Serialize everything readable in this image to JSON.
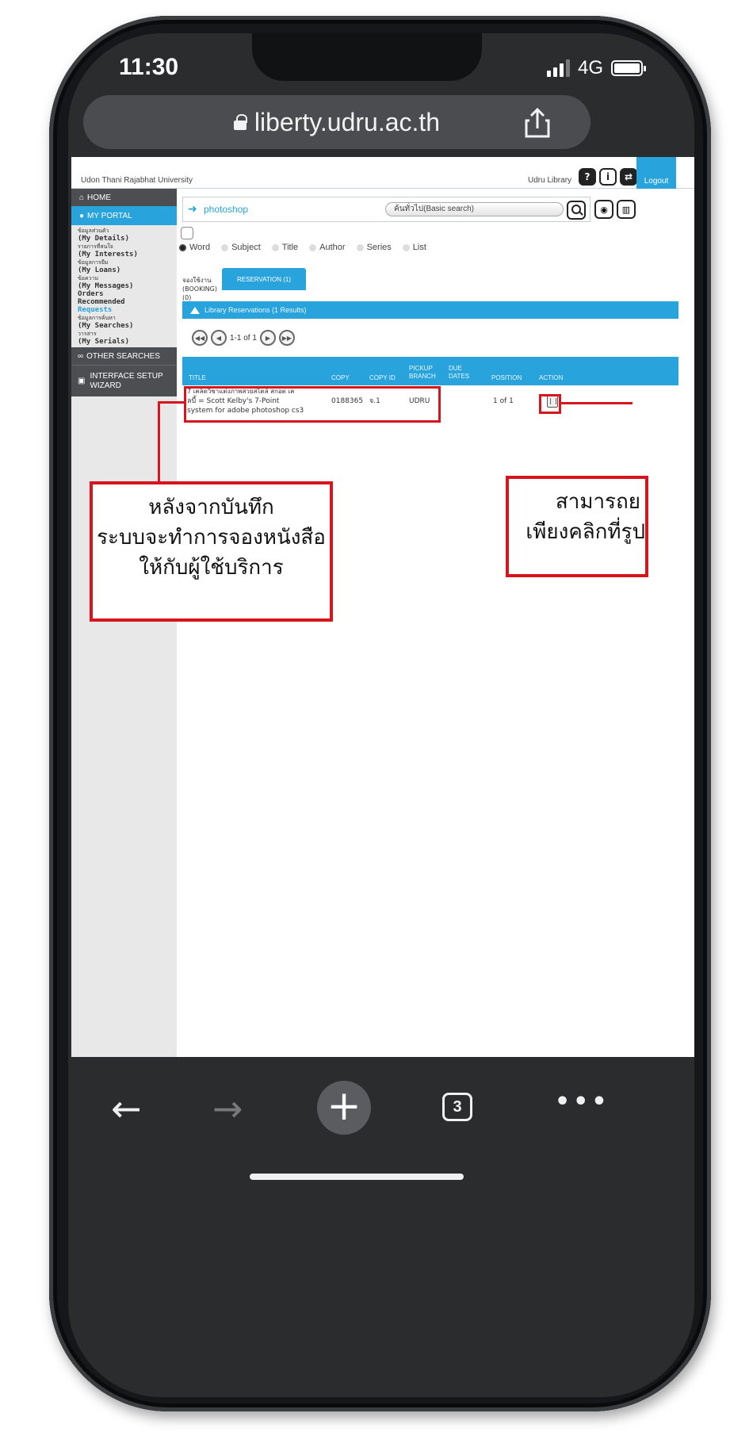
{
  "status_bar": {
    "time": "11:30",
    "network": "4G"
  },
  "browser": {
    "url": "liberty.udru.ac.th",
    "tab_count": "3"
  },
  "page": {
    "header": {
      "university": "Udon Thani Rajabhat University",
      "library_name": "Udru Library",
      "logout_label": "Logout",
      "icons": [
        "help-icon",
        "info-icon",
        "swap-icon"
      ]
    },
    "sidebar": {
      "home": "HOME",
      "my_portal": "MY PORTAL",
      "links": [
        {
          "thai": "ข้อมูลส่วนตัว",
          "en": "(My Details)"
        },
        {
          "thai": "รายการที่สนใจ",
          "en": "(My Interests)"
        },
        {
          "thai": "ข้อมูลการยืม",
          "en": "(My Loans)"
        },
        {
          "thai": "ข้อความ",
          "en": "(My Messages)"
        },
        {
          "thai": "",
          "en": "Orders"
        },
        {
          "thai": "",
          "en": "Recommended"
        },
        {
          "thai": "",
          "en": "Requests",
          "active": true
        },
        {
          "thai": "ข้อมูลการค้นหา",
          "en": "(My Searches)"
        },
        {
          "thai": "วารสาร",
          "en": "(My Serials)"
        }
      ],
      "other_searches": "OTHER SEARCHES",
      "interface_setup": "INTERFACE SETUP",
      "wizard": "WIZARD"
    },
    "search": {
      "query": "photoshop",
      "mode": "ค้นทั่วไป(Basic search)",
      "types": [
        {
          "label": "Word",
          "selected": true
        },
        {
          "label": "Subject",
          "selected": false
        },
        {
          "label": "Title",
          "selected": false
        },
        {
          "label": "Author",
          "selected": false
        },
        {
          "label": "Series",
          "selected": false
        },
        {
          "label": "List",
          "selected": false
        }
      ]
    },
    "tabs": {
      "booking_thai": "จองใช้งาน",
      "booking_en": "(BOOKING) (0)",
      "reservation": "RESERVATION (1)"
    },
    "results_title": "Library Reservations (1 Results)",
    "pager_text": "1-1 of 1",
    "table": {
      "headers": {
        "title": "TITLE",
        "copy": "COPY",
        "copy_id": "COPY ID",
        "pickup_1": "PICKUP",
        "pickup_2": "BRANCH",
        "due_1": "DUE",
        "due_2": "DATES",
        "position": "POSITION",
        "action": "ACTION"
      },
      "rows": [
        {
          "title_line1": "7 เคล็ดวิชาแต่งภาพสวยสไตล์ สกอต เค",
          "title_line2": "ลบี้ = Scott Kelby's 7-Point",
          "title_line3": "system for adobe photoshop cs3",
          "copy": "0188365",
          "copy_id": "จ.1",
          "pickup_branch": "UDRU",
          "due_dates": "",
          "position": "1 of 1"
        }
      ]
    }
  },
  "callouts": {
    "left": [
      "หลังจากบันทึก",
      "ระบบจะทำการจองหนังสือ",
      "ให้กับผู้ใช้บริการ"
    ],
    "right": [
      "สามารถย",
      "เพียงคลิกที่รูป"
    ]
  },
  "colors": {
    "accent": "#29a3dc",
    "highlight": "#d8141c",
    "sidebar_dark": "#4c4e52"
  }
}
